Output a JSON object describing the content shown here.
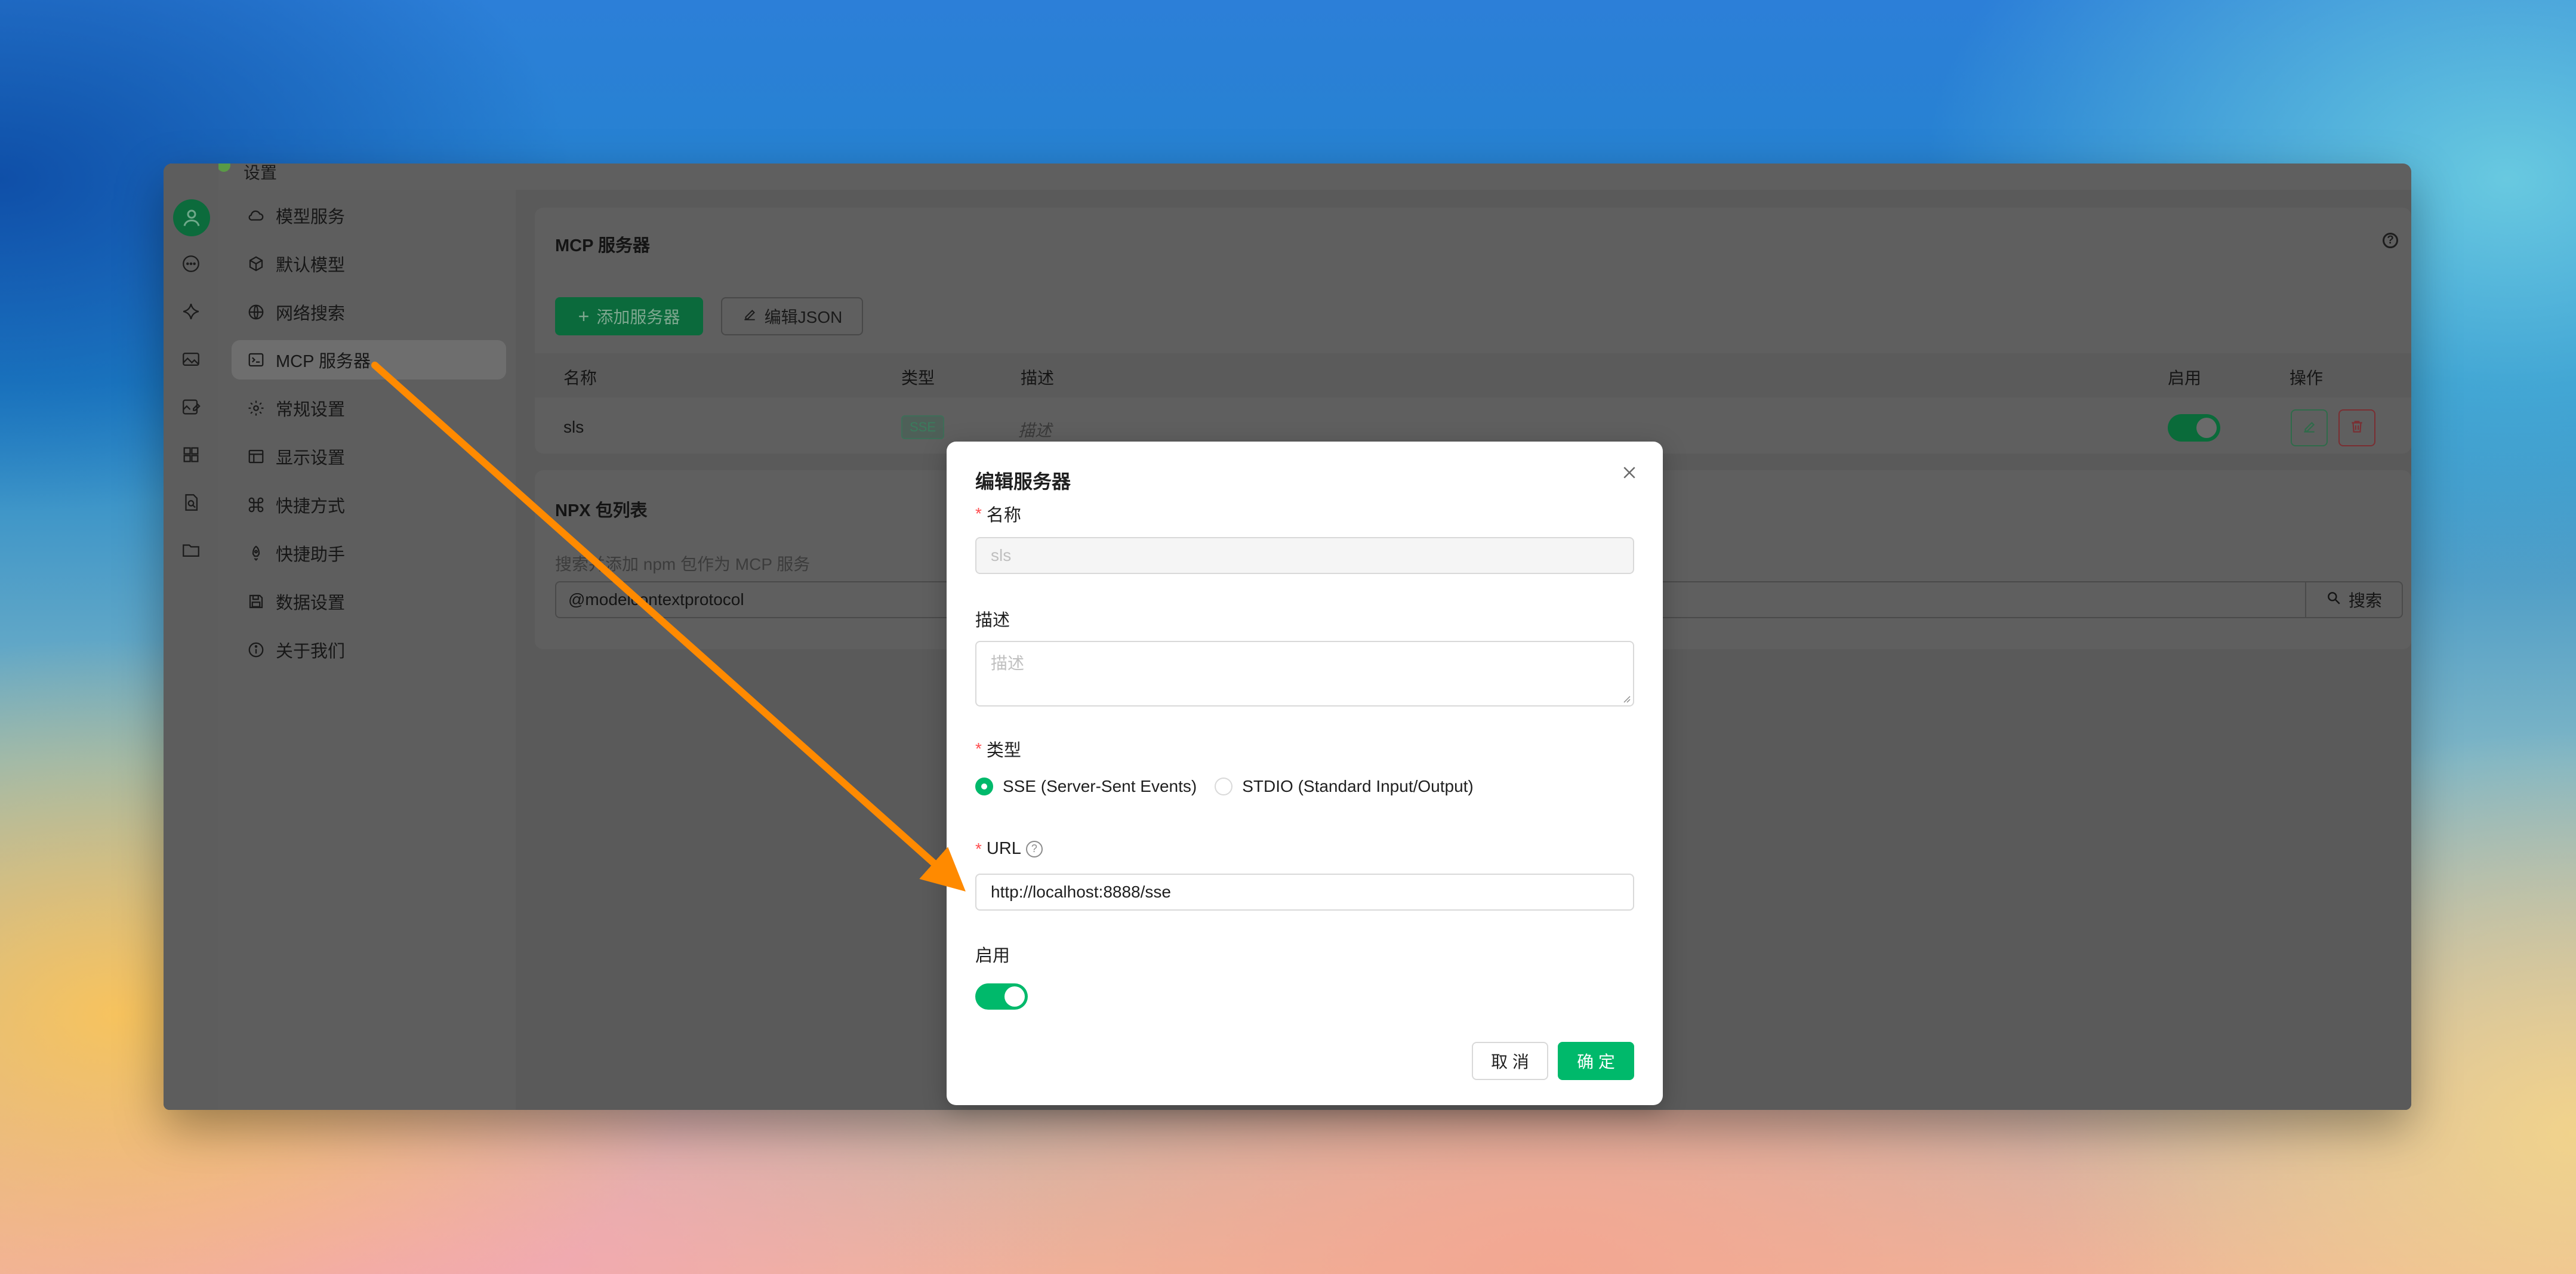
{
  "window": {
    "title": "设置"
  },
  "colors": {
    "accent": "#00b96b",
    "danger": "#ff4d4f",
    "arrow": "#ff8a00"
  },
  "rail_icons": [
    "chat-icon",
    "sparkle-icon",
    "image-icon",
    "image-edit-icon",
    "apps-icon",
    "file-search-icon",
    "folder-icon"
  ],
  "sidebar": {
    "items": [
      {
        "label": "模型服务",
        "icon": "cloud-icon"
      },
      {
        "label": "默认模型",
        "icon": "cube-icon"
      },
      {
        "label": "网络搜索",
        "icon": "globe-icon"
      },
      {
        "label": "MCP 服务器",
        "icon": "terminal-icon"
      },
      {
        "label": "常规设置",
        "icon": "gear-icon"
      },
      {
        "label": "显示设置",
        "icon": "layout-icon"
      },
      {
        "label": "快捷方式",
        "icon": "command-icon"
      },
      {
        "label": "快捷助手",
        "icon": "rocket-icon"
      },
      {
        "label": "数据设置",
        "icon": "save-icon"
      },
      {
        "label": "关于我们",
        "icon": "info-icon"
      }
    ],
    "active_index": 3
  },
  "mcp": {
    "title": "MCP 服务器",
    "add_button": "添加服务器",
    "edit_json_button": "编辑JSON",
    "columns": {
      "name": "名称",
      "type": "类型",
      "desc": "描述",
      "enabled": "启用",
      "actions": "操作"
    },
    "rows": [
      {
        "name": "sls",
        "type": "SSE",
        "desc": "描述",
        "enabled": true
      }
    ]
  },
  "npx": {
    "title": "NPX 包列表",
    "hint": "搜索并添加 npm 包作为 MCP 服务",
    "search_value": "@modelcontextprotocol",
    "search_button": "搜索"
  },
  "modal": {
    "title": "编辑服务器",
    "name_label": "名称",
    "name_value": "sls",
    "desc_label": "描述",
    "desc_placeholder": "描述",
    "type_label": "类型",
    "type_options": [
      "SSE (Server-Sent Events)",
      "STDIO (Standard Input/Output)"
    ],
    "type_selected": "SSE (Server-Sent Events)",
    "url_label": "URL",
    "url_value": "http://localhost:8888/sse",
    "enabled_label": "启用",
    "enabled": true,
    "cancel": "取 消",
    "ok": "确 定"
  }
}
